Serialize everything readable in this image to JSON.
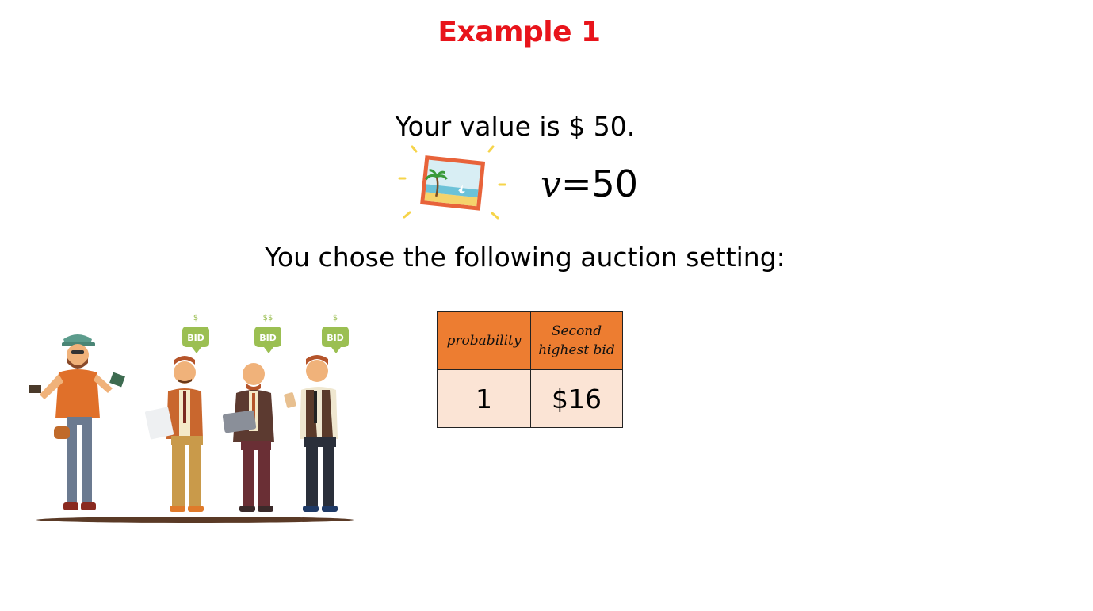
{
  "slide": {
    "title": "Example 1",
    "value_text": "Your value is $ 50.",
    "equation": {
      "variable": "v",
      "rest": "=50"
    },
    "setting_text": "You chose the following auction setting:"
  },
  "table": {
    "headers": [
      "probability",
      "Second highest bid"
    ],
    "rows": [
      [
        "1",
        "$16"
      ]
    ]
  },
  "illustrations": {
    "picture_icon": "framed-beach-picture-icon",
    "people": "bidders-illustration",
    "bid_signs": [
      "BID",
      "BID",
      "BID"
    ]
  },
  "colors": {
    "title": "#e8141b",
    "table_header": "#ed7d31",
    "table_cell": "#fbe4d5"
  }
}
